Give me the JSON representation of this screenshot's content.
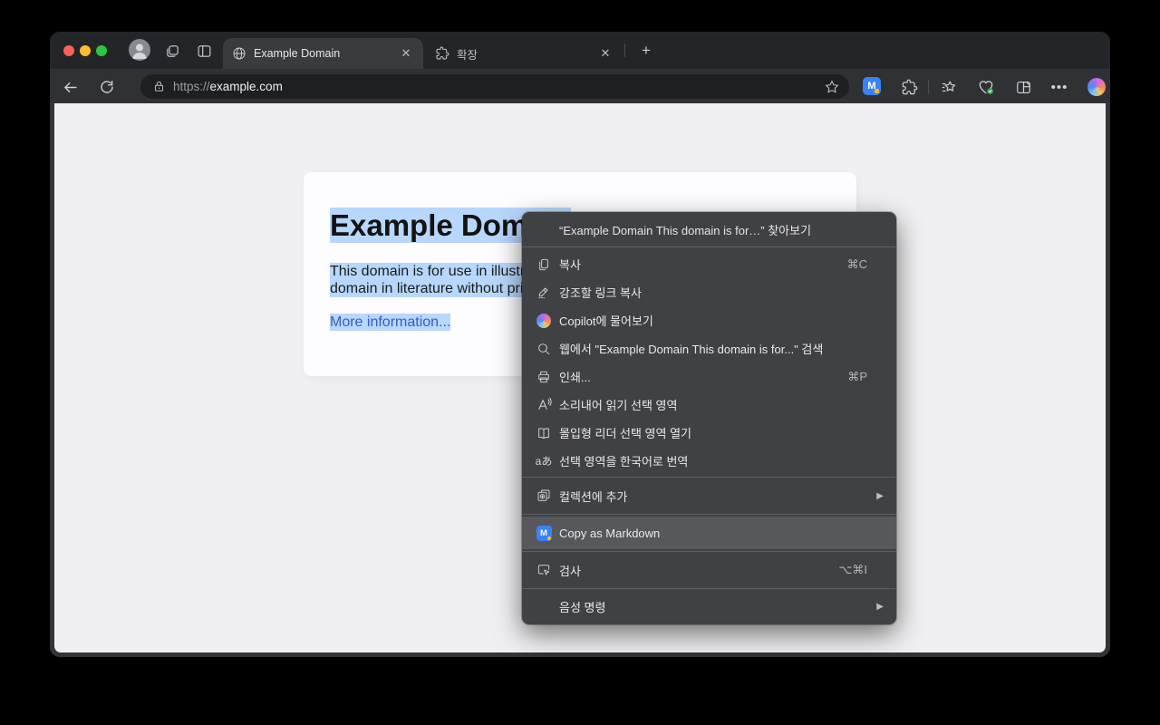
{
  "colors": {
    "selection_highlight": "#b7d7fd",
    "markdown_icon_blue": "#3b82f6",
    "link_blue": "#3c58c4",
    "menu_background": "#404144"
  },
  "tabstrip": {
    "tabs": [
      {
        "title": "Example Domain"
      },
      {
        "title": "확장"
      }
    ]
  },
  "address_bar": {
    "scheme": "https://",
    "host": "example.com"
  },
  "page": {
    "heading": "Example Domain",
    "para_line1": "This domain is for use in illustrative examples in documents. You may use this",
    "para_line2": "domain in literature without prior coordination or asking for permission.",
    "link": "More information..."
  },
  "menu": {
    "lookup": "“Example Domain This domain is for…” 찾아보기",
    "items": [
      {
        "label": "복사",
        "shortcut": "⌘C"
      },
      {
        "label": "강조할 링크 복사",
        "shortcut": ""
      },
      {
        "label": "Copilot에 물어보기",
        "shortcut": ""
      },
      {
        "label": "웹에서 \"Example Domain This domain is for...\" 검색",
        "shortcut": ""
      },
      {
        "label": "인쇄...",
        "shortcut": "⌘P"
      },
      {
        "label": "소리내어 읽기 선택 영역",
        "shortcut": ""
      },
      {
        "label": "몰입형 리더 선택 영역 열기",
        "shortcut": ""
      },
      {
        "label": "선택 영역을 한국어로 번역",
        "shortcut": ""
      }
    ],
    "collections": "컬렉션에 추가",
    "copy_as_markdown": "Copy as Markdown",
    "inspect": "검사",
    "inspect_shortcut": "⌥⌘I",
    "voice_commands": "음성 명령"
  }
}
